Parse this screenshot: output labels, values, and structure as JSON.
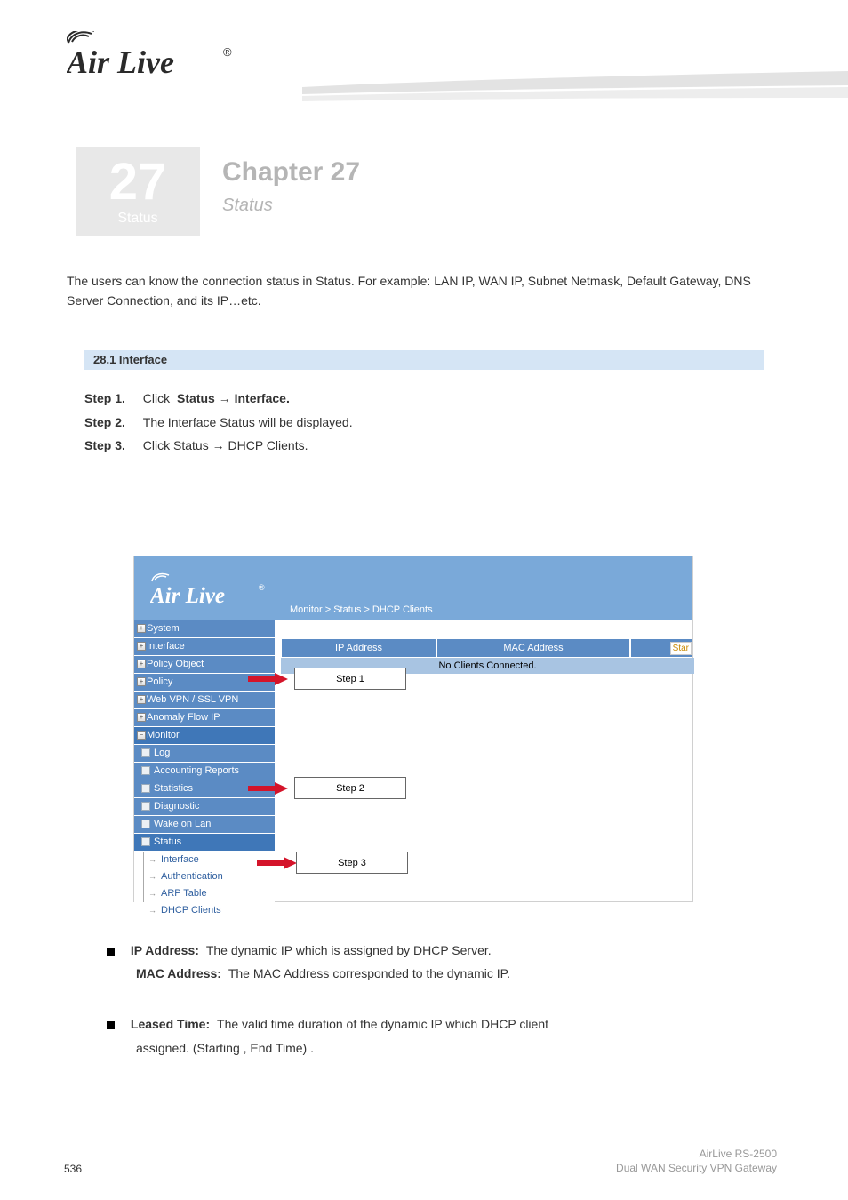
{
  "chapter": {
    "number": "27",
    "label": "Status",
    "heading": "Chapter 27",
    "subheading": "Status"
  },
  "intro": "The users can know the connection status in Status. For example: LAN IP, WAN IP, Subnet Netmask, Default Gateway, DNS Server Connection, and its IP…etc.",
  "section_title": "28.1 Interface",
  "section_body": {
    "l1": "Step 1.",
    "l1b": "Click",
    "l1c": "Status → Interface.",
    "l2a": "Step 2.",
    "l2b": "The Interface Status will be displayed.",
    "l3a": "Step 3.",
    "l3b": "Click Status → DHCP Clients."
  },
  "ui": {
    "breadcrumb": "Monitor > Status > DHCP Clients",
    "nav": {
      "system": "System",
      "interface": "Interface",
      "policy_object": "Policy Object",
      "policy": "Policy",
      "webvpn": "Web VPN / SSL VPN",
      "anomaly": "Anomaly Flow IP",
      "monitor": "Monitor",
      "log": "Log",
      "accounting": "Accounting Reports",
      "statistics": "Statistics",
      "diagnostic": "Diagnostic",
      "wake": "Wake on Lan",
      "status": "Status",
      "leaf_interface": "Interface",
      "leaf_auth": "Authentication",
      "leaf_arp": "ARP Table",
      "leaf_dhcp": "DHCP Clients"
    },
    "table": {
      "ip": "IP Address",
      "mac": "MAC Address",
      "star": "Star",
      "noclient": "No Clients Connected."
    },
    "steps": {
      "s1": "Step 1",
      "s2": "Step 2",
      "s3": "Step 3"
    }
  },
  "bullets": {
    "b1a": "IP Address:",
    "b1b": "The dynamic IP which is assigned by DHCP Server.",
    "b2a": "MAC Address:",
    "b2b": "The MAC Address corresponded to the dynamic IP.",
    "b3a": "Leased Time:",
    "b3b": "The valid time duration of the dynamic IP which DHCP client",
    "b4": "assigned. (Starting , End Time) ."
  },
  "footer": {
    "page": "536",
    "model1": "AirLive RS-2500",
    "model2": "Dual WAN Security VPN Gateway"
  }
}
